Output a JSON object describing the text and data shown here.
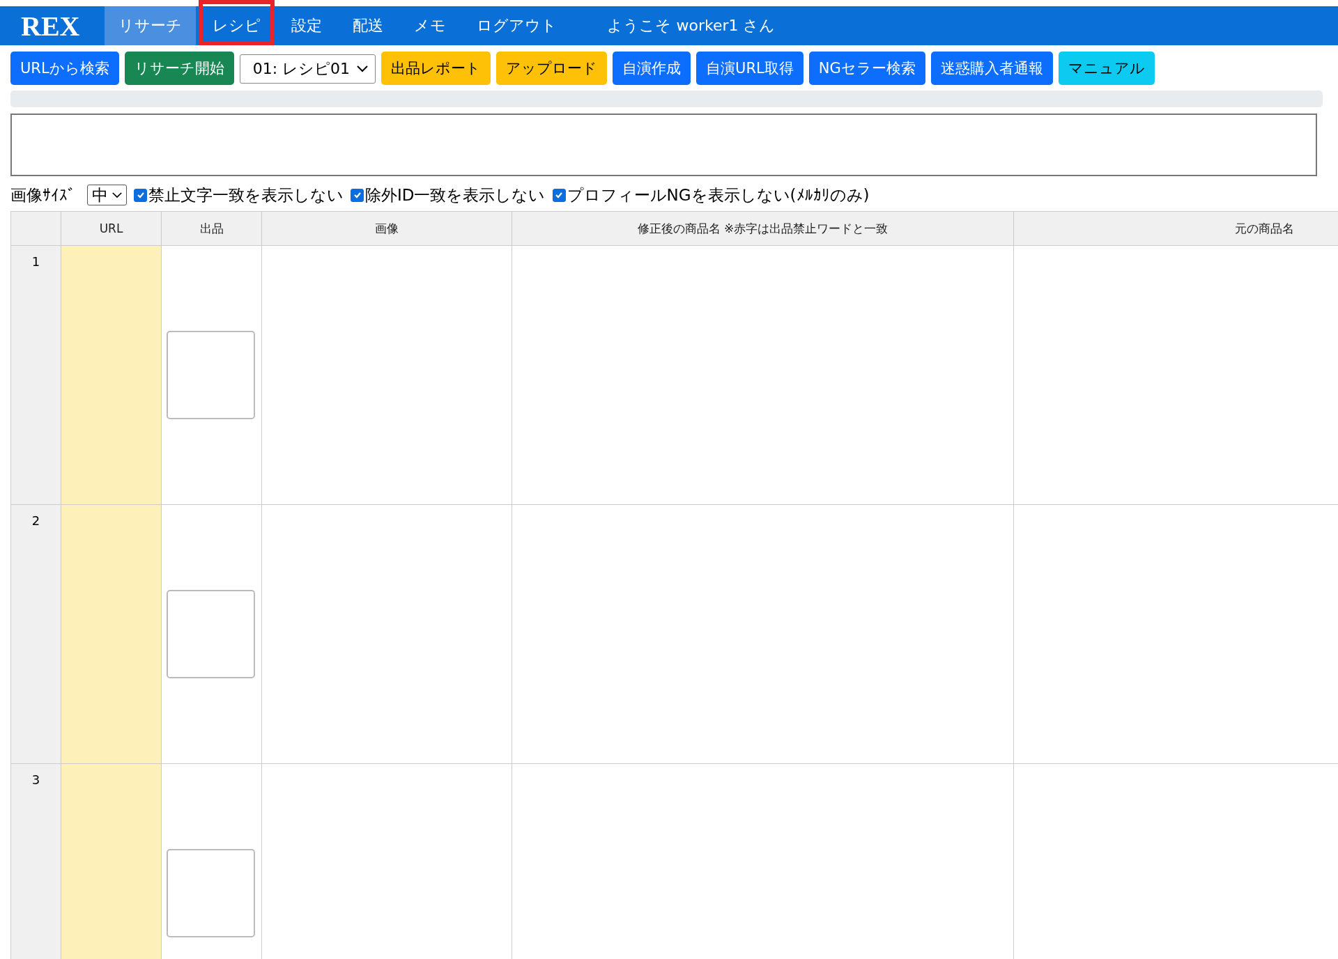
{
  "brand": "REX",
  "nav": [
    {
      "label": "リサーチ",
      "selected": true,
      "highlighted": false
    },
    {
      "label": "レシピ",
      "selected": false,
      "highlighted": true
    },
    {
      "label": "設定",
      "selected": false,
      "highlighted": false
    },
    {
      "label": "配送",
      "selected": false,
      "highlighted": false
    },
    {
      "label": "メモ",
      "selected": false,
      "highlighted": false
    },
    {
      "label": "ログアウト",
      "selected": false,
      "highlighted": false
    }
  ],
  "welcome": "ようこそ worker1 さん",
  "toolbar": [
    {
      "kind": "button",
      "label": "URLから検索",
      "color": "#0d6efd"
    },
    {
      "kind": "button",
      "label": "リサーチ開始",
      "color": "#198754"
    },
    {
      "kind": "select",
      "label": "01: レシピ01"
    },
    {
      "kind": "button",
      "label": "出品レポート",
      "color": "#ffc107"
    },
    {
      "kind": "button",
      "label": "アップロード",
      "color": "#ffc107"
    },
    {
      "kind": "button",
      "label": "自演作成",
      "color": "#0d6efd"
    },
    {
      "kind": "button",
      "label": "自演URL取得",
      "color": "#0d6efd"
    },
    {
      "kind": "button",
      "label": "NGセラー検索",
      "color": "#0d6efd"
    },
    {
      "kind": "button",
      "label": "迷惑購入者通報",
      "color": "#0d6efd"
    },
    {
      "kind": "button",
      "label": "マニュアル",
      "color": "#0dcaf0"
    }
  ],
  "progress": {
    "level": 0
  },
  "options": {
    "image_size_label": "画像ｻｲｽﾞ",
    "image_size": "中",
    "checkboxes": [
      {
        "label": "禁止文字一致を表示しない",
        "checked": true
      },
      {
        "label": "除外ID一致を表示しない",
        "checked": true
      },
      {
        "label": "プロフィールNGを表示しない(ﾒﾙｶﾘのみ)",
        "checked": true
      }
    ]
  },
  "table": {
    "columns": [
      "URL",
      "出品",
      "画像",
      "修正後の商品名 ※赤字は出品禁止ワードと一致",
      "元の商品名"
    ],
    "rows": [
      {
        "number": "1"
      },
      {
        "number": "2"
      },
      {
        "number": "3"
      }
    ]
  }
}
